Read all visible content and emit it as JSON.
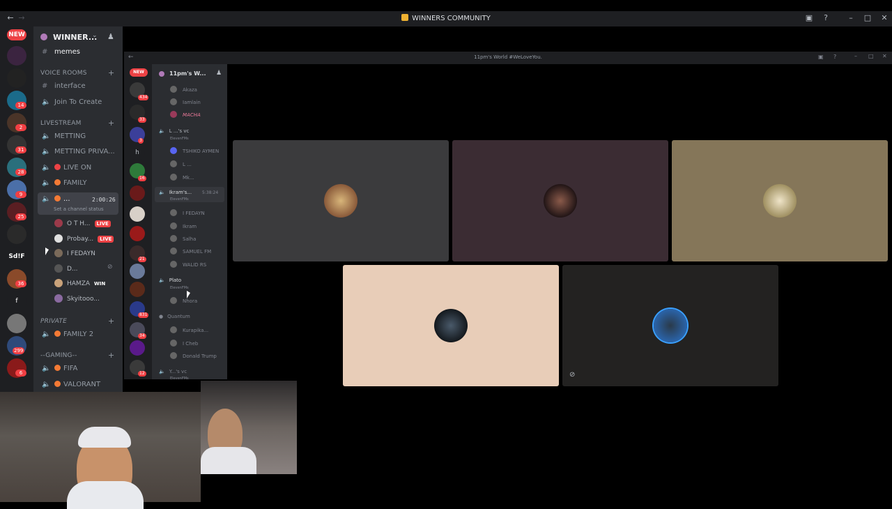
{
  "window": {
    "title": "WINNERS COMMUNITY"
  },
  "rail": {
    "new_badge": "NEW",
    "servers": [
      {
        "name": "ea-server",
        "badge": "14"
      },
      {
        "name": "server-2",
        "badge": "2"
      },
      {
        "name": "server-3",
        "badge": "31"
      },
      {
        "name": "server-4",
        "badge": "28"
      },
      {
        "name": "server-5",
        "badge": "9"
      },
      {
        "name": "server-6",
        "badge": "25"
      },
      {
        "name": "server-7",
        "badge": ""
      },
      {
        "name": "Sd!F",
        "badge": ""
      },
      {
        "name": "server-9",
        "badge": "36"
      },
      {
        "name": "f",
        "badge": ""
      },
      {
        "name": "server-11",
        "badge": ""
      },
      {
        "name": "server-12",
        "badge": "299"
      },
      {
        "name": "server-13",
        "badge": "6"
      }
    ]
  },
  "sidebar": {
    "server_name": "WINNER...",
    "top_channel": "memes",
    "categories": {
      "voice_rooms": "VOICE ROOMS",
      "livestream": "LIVESTREAM",
      "private": "PRIVATE",
      "gaming": "--GAMING--"
    },
    "voice_rooms": [
      "interface",
      "Join To Create"
    ],
    "livestream": [
      "METTING",
      "METTING PRIVA...",
      "LIVE ON",
      "FAMILY"
    ],
    "active_channel": {
      "name": "...",
      "timer": "2:00:26",
      "status": "Set a channel status"
    },
    "users": [
      {
        "name": "O T H...",
        "tag": "LIVE"
      },
      {
        "name": "Probay...",
        "tag": "LIVE"
      },
      {
        "name": "I FEDAYN",
        "tag": ""
      },
      {
        "name": "D...",
        "tag": ""
      },
      {
        "name": "HAMZA",
        "tag": "WIN"
      },
      {
        "name": "Skyitooo...",
        "tag": ""
      }
    ],
    "private": [
      "FAMILY 2"
    ],
    "gaming": [
      "FIFA",
      "VALORANT"
    ]
  },
  "embedded": {
    "title": "11pm's World #WeLoveYou.",
    "server_name": "11pm's W...",
    "new_badge": "NEW",
    "rail_badges": [
      "434",
      "33",
      "3",
      "16",
      "21",
      "831",
      "34",
      "12"
    ],
    "rail_letter": "h",
    "items": [
      "Akaza",
      "Iamlain",
      "MACHA",
      "L ...'s vc",
      "ElevenFMs",
      "TSHIKO AYMEN",
      "L ...",
      "Mk...",
      "Ikram's...",
      "5:38:24",
      "ElevenFMs",
      "I FEDAYN",
      "Ikram",
      "Salha",
      "SAMUEL FM",
      "WALID RS",
      "Plato",
      "ElevenFMs",
      "Nhora",
      "Quantum",
      "Kurapika...",
      "I Cheb",
      "Donald Trump",
      "Y...'s vc",
      "ElevenFMs"
    ]
  },
  "colors": {
    "tile1": "#3b3b3d",
    "tile2": "#3b2c33",
    "tile3": "#857659",
    "tile4": "#e8cdb8",
    "tile5": "#232221",
    "accent_red": "#ed4245"
  }
}
